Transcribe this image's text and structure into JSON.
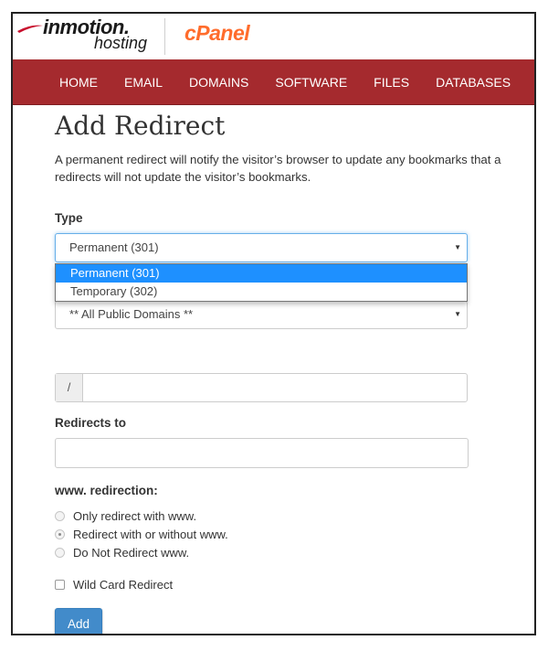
{
  "header": {
    "brand_name": "inmotion.",
    "brand_sub": "hosting",
    "product": "cPanel",
    "colors": {
      "nav_bg": "#a52a2e",
      "cpanel_orange": "#ff6c2c",
      "button_blue": "#428bca",
      "selected_blue": "#1e90ff"
    }
  },
  "nav": {
    "items": [
      {
        "label": "HOME"
      },
      {
        "label": "EMAIL"
      },
      {
        "label": "DOMAINS"
      },
      {
        "label": "SOFTWARE"
      },
      {
        "label": "FILES"
      },
      {
        "label": "DATABASES"
      }
    ]
  },
  "page": {
    "title": "Add Redirect",
    "description_line1": "A permanent redirect will notify the visitor’s browser to update any bookmarks that a",
    "description_line2": "redirects will not update the visitor’s bookmarks."
  },
  "form": {
    "type_label": "Type",
    "type_value": "Permanent (301)",
    "type_options": [
      {
        "label": "Permanent (301)",
        "selected": true
      },
      {
        "label": "Temporary (302)",
        "selected": false
      }
    ],
    "domain_value": "** All Public Domains **",
    "path_prefix": "/",
    "path_value": "",
    "redirects_to_label": "Redirects to",
    "redirects_to_value": "",
    "www_label": "www. redirection:",
    "www_options": [
      {
        "label": "Only redirect with www.",
        "checked": false
      },
      {
        "label": "Redirect with or without www.",
        "checked": true
      },
      {
        "label": "Do Not Redirect www.",
        "checked": false
      }
    ],
    "wildcard_label": "Wild Card Redirect",
    "wildcard_checked": false,
    "add_label": "Add"
  }
}
